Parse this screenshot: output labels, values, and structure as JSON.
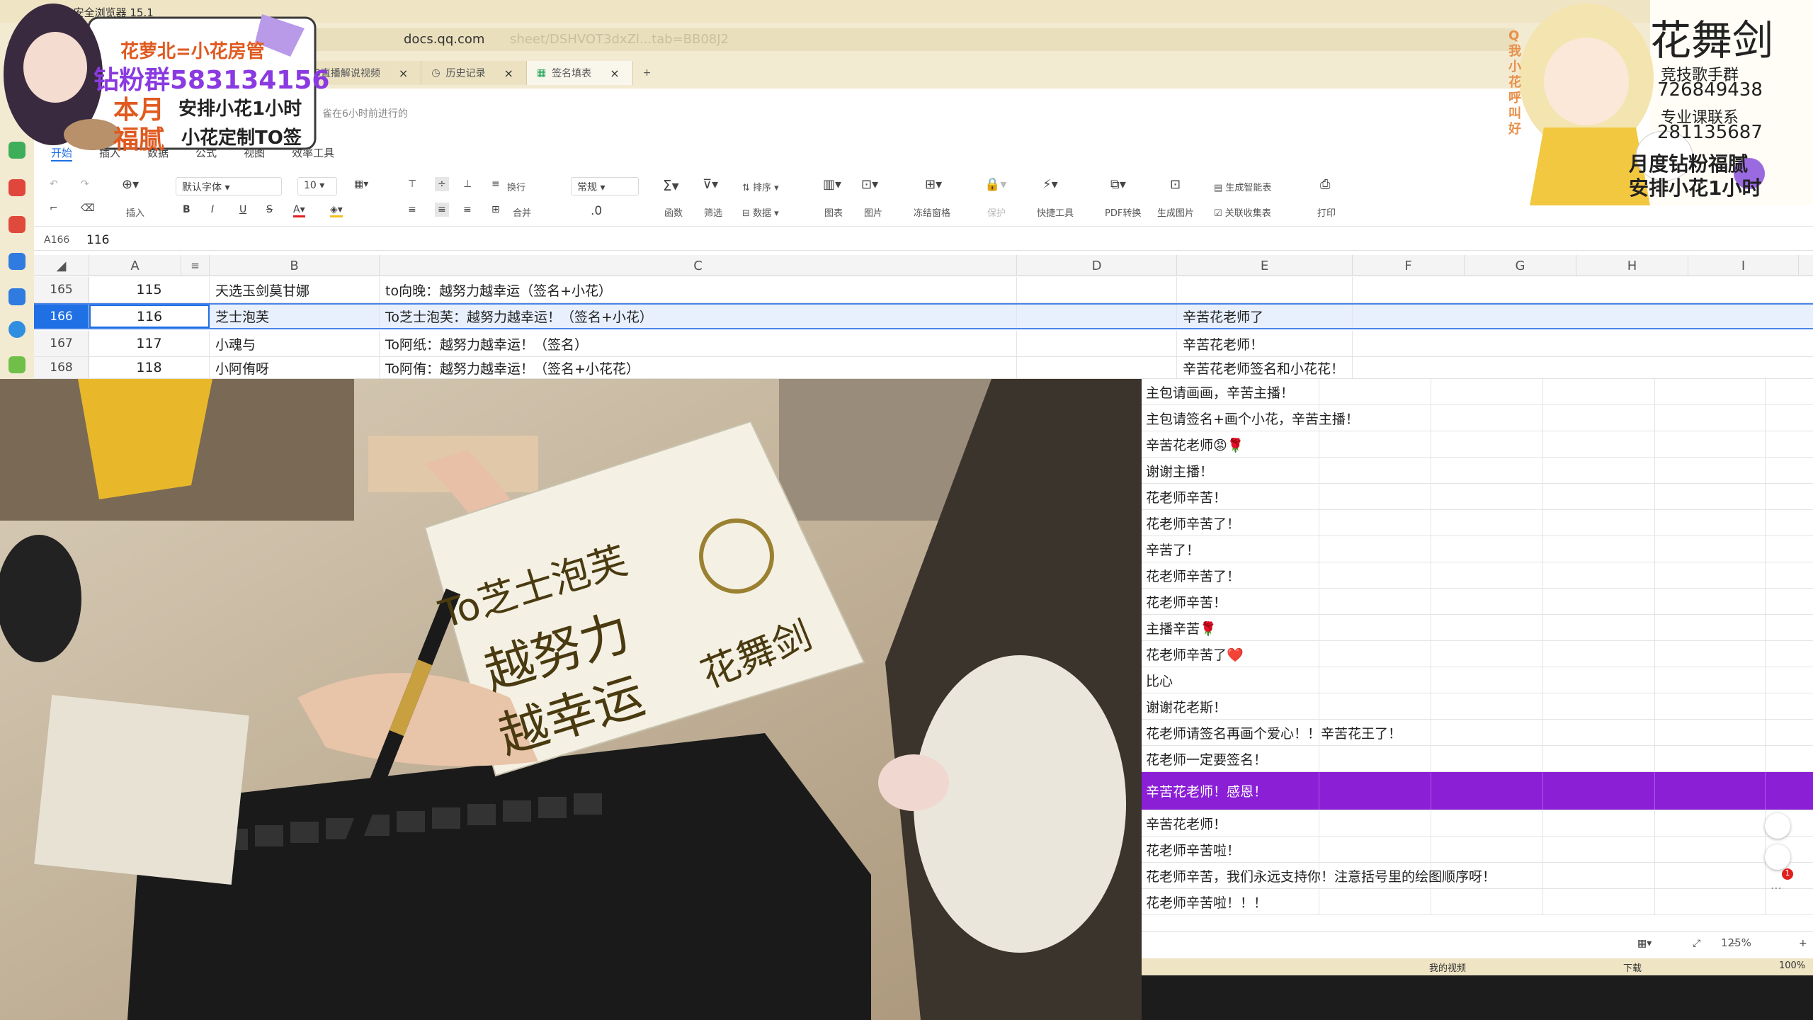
{
  "browser": {
    "title": "QQ安全浏览器 15.1",
    "url_host": "docs.qq.com",
    "url_ghost": "sheet/DSHVOT3dxZl...tab=BB08J2",
    "tabs": [
      {
        "label": "3直播解说视频",
        "close": "×"
      },
      {
        "label": "历史记录",
        "close": "×"
      },
      {
        "label": "签名填表",
        "close": "×"
      }
    ]
  },
  "doc": {
    "meta": "雀在6小时前进行的",
    "ribbon_tabs": [
      "开始",
      "插入",
      "数据",
      "公式",
      "视图",
      "效率工具"
    ],
    "toolbar": {
      "insert": "插入",
      "font": "默认字体",
      "font_size": "10",
      "wrap": "换行",
      "merge": "合并",
      "number_format": "常规",
      "decimal": ".0",
      "func": "函数",
      "filter": "筛选",
      "sort": "排序",
      "data": "数据",
      "chart": "图表",
      "image": "图片",
      "freeze": "冻结窗格",
      "protect": "保护",
      "quick": "快捷工具",
      "pdf": "PDF转换",
      "gen_img": "生成图片",
      "smart_form": "生成智能表",
      "collect": "关联收集表",
      "print": "打印"
    },
    "cell_ref": "A166",
    "formula_value": "116"
  },
  "grid": {
    "columns": [
      "A",
      "B",
      "C",
      "D",
      "E",
      "F",
      "G",
      "H",
      "I"
    ],
    "rows": [
      {
        "rownum": "165",
        "a": "115",
        "b": "天选玉剑莫甘娜",
        "c": "to向晚：越努力越幸运（签名+小花）",
        "e": ""
      },
      {
        "rownum": "166",
        "a": "116",
        "b": "芝士泡芙",
        "c": "To芝士泡芙：越努力越幸运！（签名+小花）",
        "e": "辛苦花老师了"
      },
      {
        "rownum": "167",
        "a": "117",
        "b": "小魂与",
        "c": "To阿纸：越努力越幸运！（签名）",
        "e": "辛苦花老师！"
      },
      {
        "rownum": "168",
        "a": "118",
        "b": "小阿侑呀",
        "c": "To阿侑：越努力越幸运！（签名+小花花）",
        "e": "辛苦花老师签名和小花花！"
      }
    ],
    "comments": [
      "主包请画画，辛苦主播！",
      "主包请签名+画个小花，辛苦主播！",
      "辛苦花老师😡🌹",
      "谢谢主播！",
      "花老师辛苦！",
      "花老师辛苦了！",
      "辛苦了！",
      "花老师辛苦了！",
      "花老师辛苦！",
      "主播辛苦🌹",
      "花老师辛苦了❤️",
      "比心",
      "谢谢花老斯！",
      "花老师请签名再画个爱心！！辛苦花王了！",
      "花老师一定要签名！",
      "辛苦花老师！感恩！",
      "辛苦花老师！",
      "花老师辛苦啦！",
      "花老师辛苦，我们永远支持你！注意括号里的绘图顺序呀！",
      "花老师辛苦啦！！！"
    ],
    "highlight_index": 15,
    "highlight_color": "#8b1fd6"
  },
  "status": {
    "zoom": "125%",
    "my_video": "我的视频",
    "download": "下载",
    "percent": "100%"
  },
  "overlay_left": {
    "line1": "花萝北=小花房管",
    "line2": "钻粉群583134156",
    "line3a": "本月",
    "line3b": "安排小花1小时",
    "line4a": "福腻",
    "line4b": "小花定制TO签"
  },
  "overlay_right": {
    "title": "花舞剑",
    "line1": "竞技歌手群",
    "line2": "726849438",
    "line3": "专业课联系",
    "line4": "281135687",
    "line5": "月度钻粉福腻",
    "line6": "安排小花1小时",
    "side": "Q我小花呼叫好"
  },
  "card": {
    "line1": "To芝士泡芙",
    "line2": "越努力",
    "line3": "越幸运",
    "signature": "花舞剑"
  },
  "colors": {
    "chrome": "#f3ead2",
    "accent": "#1f6fe5",
    "highlight": "#8b1fd6"
  }
}
